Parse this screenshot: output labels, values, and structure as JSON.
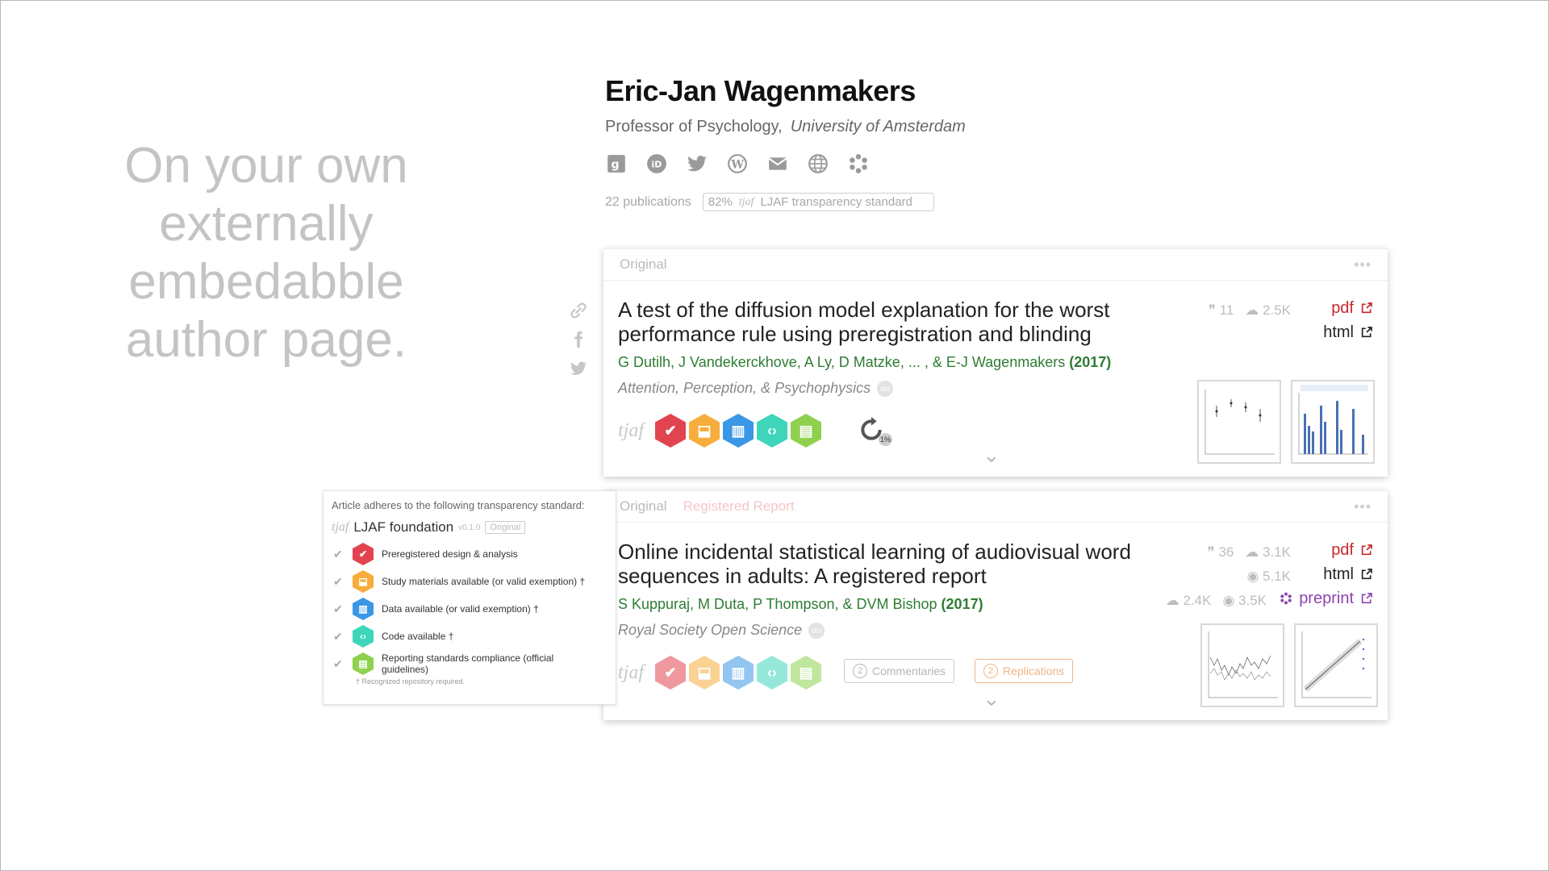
{
  "tagline": "On your own externally embedabble author page.",
  "profile": {
    "name": "Eric-Jan Wagenmakers",
    "role": "Professor of Psychology,",
    "university": "University of Amsterdam",
    "social_icons": [
      "google-scholar-icon",
      "orcid-icon",
      "twitter-icon",
      "wordpress-icon",
      "email-icon",
      "globe-icon",
      "osf-icon"
    ],
    "publications": "22 publications",
    "ljaf_percent": "82%",
    "ljaf_logo": "tjaf",
    "ljaf_label": "LJAF transparency standard"
  },
  "share": [
    "link-icon",
    "facebook-icon",
    "twitter-icon"
  ],
  "cards": [
    {
      "kind": "Original",
      "title": "A test of the diffusion model explanation for the worst performance rule using preregistration and blinding",
      "authors": "G Dutilh, J Vandekerckhove, A Ly, D Matzke, ... , & E-J Wagenmakers",
      "year": "(2017)",
      "journal": "Attention, Perception, & Psychophysics",
      "doi": "doi",
      "citations": "11",
      "downloads": "2.5K",
      "pdf": "pdf",
      "html": "html",
      "replication": "1%"
    },
    {
      "kind": "Original",
      "registered": "Registered Report",
      "title": "Online incidental statistical learning of audiovisual word sequences in adults: A registered report",
      "authors": "S Kuppuraj, M Duta, P Thompson, & DVM Bishop",
      "year": "(2017)",
      "journal": "Royal Society Open Science",
      "doi": "doi",
      "citations": "36",
      "downloads": "3.1K",
      "views": "5.1K",
      "preprint_downloads": "2.4K",
      "preprint_views": "3.5K",
      "pdf": "pdf",
      "html": "html",
      "preprint": "preprint",
      "commentaries_count": "2",
      "commentaries_label": "Commentaries",
      "replications_count": "2",
      "replications_label": "Replications"
    }
  ],
  "popup": {
    "header": "Article adheres to the following transparency standard:",
    "standard": "LJAF foundation",
    "version": "v0.1.0",
    "tag": "Original",
    "items": [
      "Preregistered design & analysis",
      "Study materials available (or valid exemption) †",
      "Data available (or valid exemption) †",
      "Code available †",
      "Reporting standards compliance  (official guidelines)"
    ],
    "footnote": "† Recognized repository required."
  },
  "colors": {
    "prereg": "#e2444f",
    "materials": "#f6ad3c",
    "data": "#3a97e6",
    "code": "#3ed5bb",
    "reporting": "#8fd14f",
    "author_green": "#2e7d32",
    "pdf_red": "#c62828",
    "preprint_purple": "#8e44ad"
  }
}
